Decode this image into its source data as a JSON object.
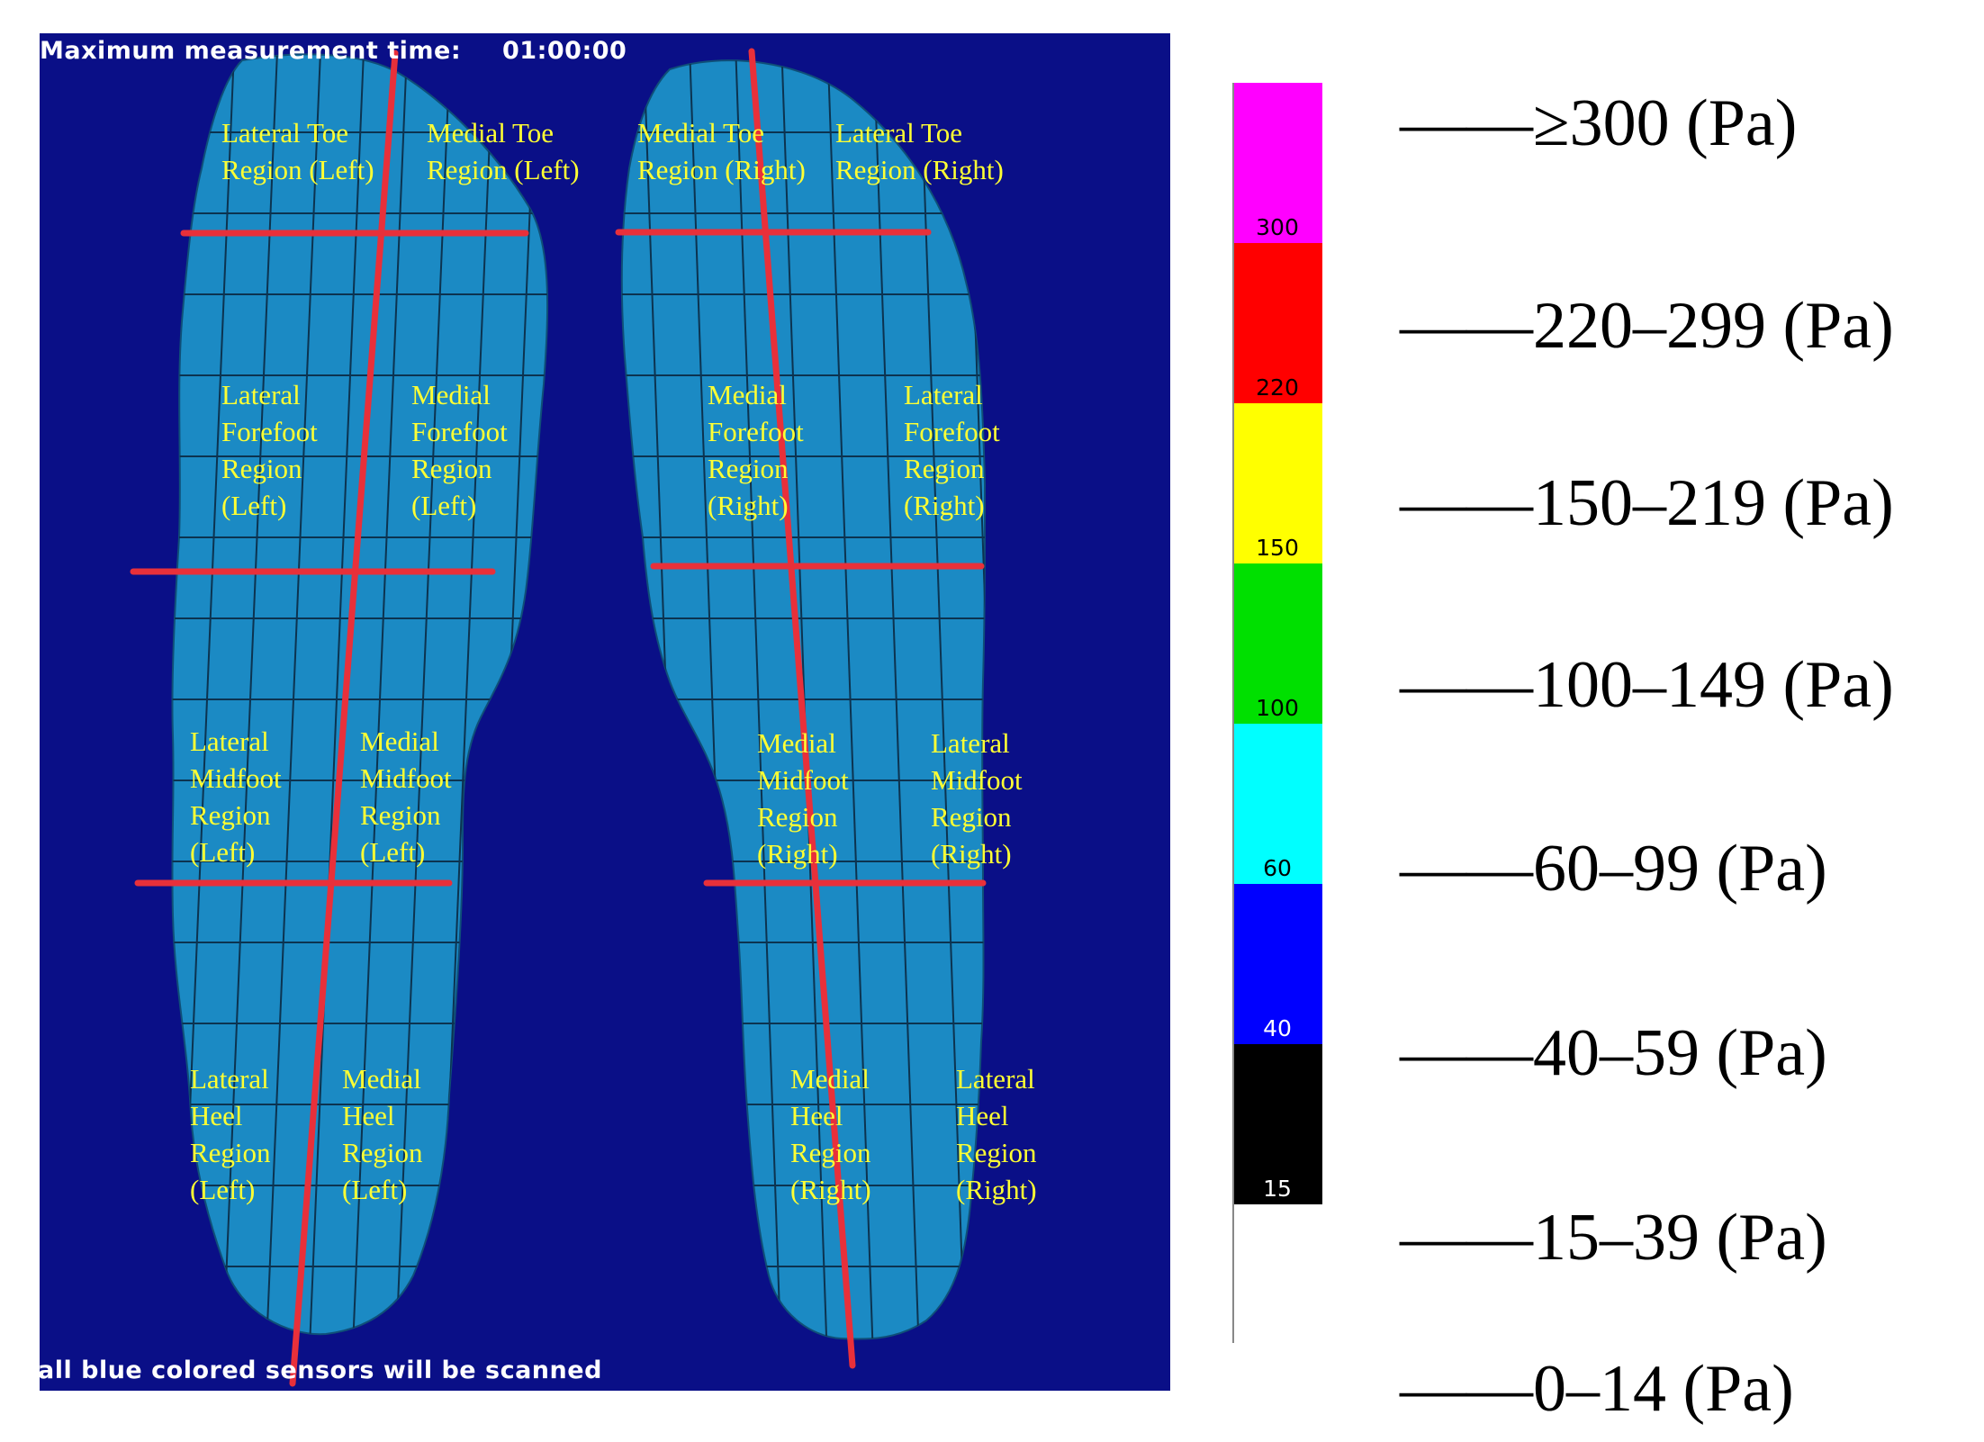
{
  "header": {
    "max_time_label": "Maximum measurement time:",
    "max_time_value": "01:00:00"
  },
  "footer_text": "all blue colored sensors will be scanned",
  "regions": {
    "left": {
      "lateral_toe": "Lateral Toe\nRegion (Left)",
      "medial_toe": "Medial Toe\nRegion (Left)",
      "lateral_forefoot": "Lateral\nForefoot\nRegion\n(Left)",
      "medial_forefoot": "Medial\nForefoot\nRegion\n(Left)",
      "lateral_midfoot": "Lateral\nMidfoot\nRegion\n(Left)",
      "medial_midfoot": "Medial\nMidfoot\nRegion\n(Left)",
      "lateral_heel": "Lateral\nHeel\nRegion\n(Left)",
      "medial_heel": "Medial\nHeel\nRegion\n(Left)"
    },
    "right": {
      "medial_toe": "Medial Toe\nRegion (Right)",
      "lateral_toe": "Lateral Toe\nRegion (Right)",
      "medial_forefoot": "Medial\nForefoot\nRegion\n(Right)",
      "lateral_forefoot": "Lateral\nForefoot\nRegion\n(Right)",
      "medial_midfoot": "Medial\nMidfoot\nRegion\n(Right)",
      "lateral_midfoot": "Lateral\nMidfoot\nRegion\n(Right)",
      "medial_heel": "Medial\nHeel\nRegion\n(Right)",
      "lateral_heel": "Lateral\nHeel\nRegion\n(Right)"
    }
  },
  "scale": {
    "segments": [
      {
        "color": "#ff00ff",
        "tick": "300",
        "legend": "——≥300 (Pa)"
      },
      {
        "color": "#ff0000",
        "tick": "220",
        "legend": "——220–299 (Pa)"
      },
      {
        "color": "#ffff00",
        "tick": "150",
        "legend": "——150–219 (Pa)"
      },
      {
        "color": "#00e000",
        "tick": "100",
        "legend": "——100–149 (Pa)"
      },
      {
        "color": "#00ffff",
        "tick": "60",
        "legend": "——60–99 (Pa)"
      },
      {
        "color": "#0000ff",
        "tick": "40",
        "legend": "——40–59 (Pa)"
      },
      {
        "color": "#000000",
        "tick": "15",
        "legend": "——15–39 (Pa)"
      },
      {
        "color": "#ffffff",
        "tick": "",
        "legend": "——0–14 (Pa)"
      }
    ]
  },
  "colors": {
    "background": "#0a0f87",
    "sensor_blue": "#1b8ac4",
    "divider_red": "#e8303a",
    "label_yellow": "#ffff33"
  }
}
